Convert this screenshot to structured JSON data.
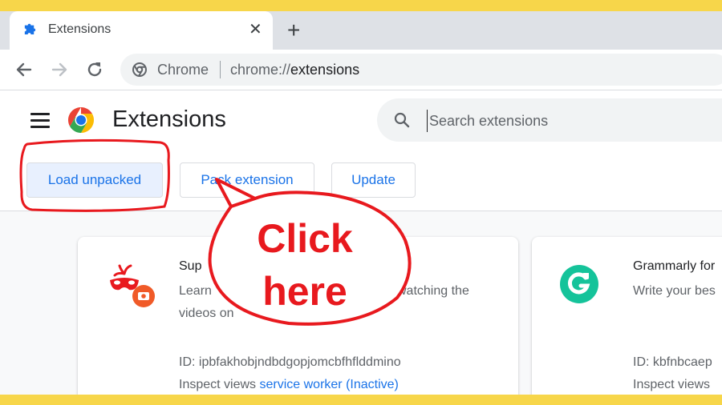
{
  "browser": {
    "tab": {
      "title": "Extensions",
      "close_glyph": "✕"
    },
    "new_tab_glyph": "+",
    "omnibox": {
      "site_label": "Chrome",
      "url_scheme": "chrome://",
      "url_path": "extensions"
    }
  },
  "page": {
    "title": "Extensions",
    "search": {
      "placeholder": "Search extensions"
    },
    "buttons": {
      "load_unpacked": "Load unpacked",
      "pack_extension": "Pack extension",
      "update": "Update"
    },
    "cards": [
      {
        "name": "Sup",
        "description_line1": "Learn",
        "description_line1_tail": "watching the",
        "description_line2": "videos on",
        "id": "ID: ipbfakhobjndbdgopjomcbfhflddmino",
        "inspect_label": "Inspect views",
        "inspect_link": "service worker (Inactive)",
        "icon": "masquerade-mask-icon"
      },
      {
        "name": "Grammarly for",
        "description": "Write your bes",
        "id": "ID: kbfnbcaep",
        "inspect_label": "Inspect views",
        "icon": "grammarly-icon"
      }
    ]
  },
  "annotation": {
    "callout_line1": "Click",
    "callout_line2": "here",
    "color": "#e8191e"
  },
  "colors": {
    "frame": "#f7d64a",
    "accent": "#1a73e8"
  }
}
